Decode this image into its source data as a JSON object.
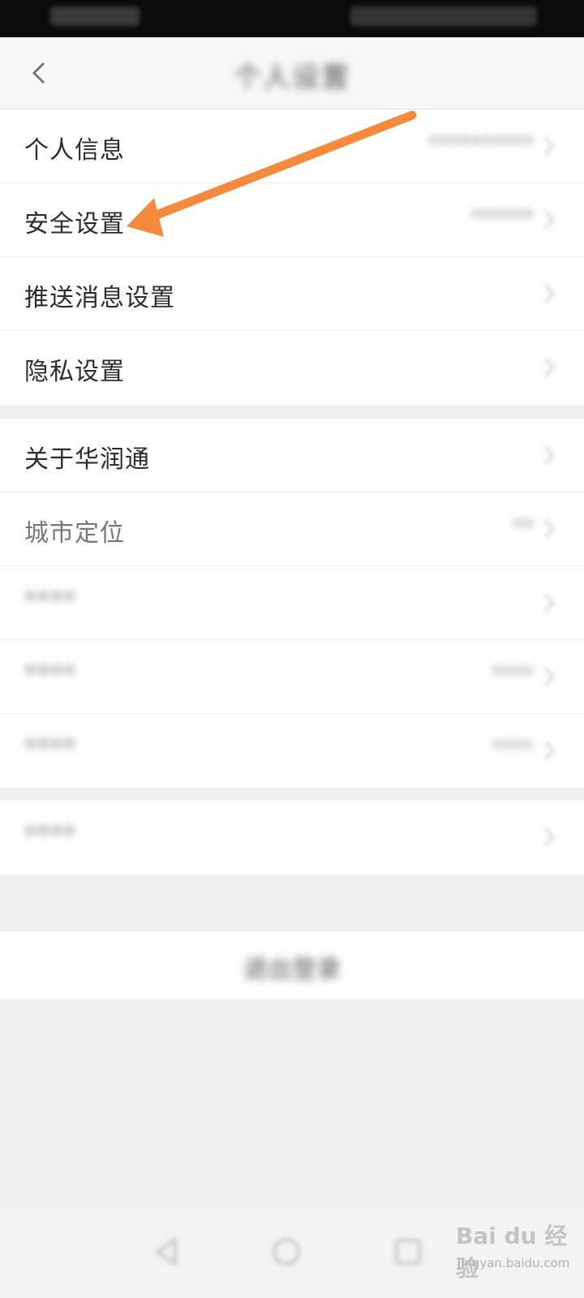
{
  "header": {
    "title": "个人设置"
  },
  "group1": {
    "items": [
      {
        "label": "个人信息",
        "value": "**********"
      },
      {
        "label": "安全设置",
        "value": "******"
      },
      {
        "label": "推送消息设置",
        "value": ""
      },
      {
        "label": "隐私设置",
        "value": ""
      }
    ]
  },
  "group2": {
    "items": [
      {
        "label": "关于华润通",
        "value": ""
      },
      {
        "label": "城市定位",
        "value": "**"
      },
      {
        "label": "****",
        "value": ""
      },
      {
        "label": "****",
        "value": "****"
      },
      {
        "label": "****",
        "value": "****"
      }
    ]
  },
  "group3": {
    "items": [
      {
        "label": "****",
        "value": ""
      }
    ]
  },
  "logout": {
    "label": "退出登录"
  },
  "watermark": {
    "brand": "Bai du 经验",
    "sub": "jingyan.baidu.com"
  },
  "colors": {
    "arrow": "#f58a3c",
    "background": "#efefef",
    "row_bg": "#ffffff",
    "text": "#2c2c2c"
  },
  "icons": {
    "back": "chevron-left-icon",
    "row": "chevron-right-icon",
    "annotation": "orange-arrow"
  }
}
